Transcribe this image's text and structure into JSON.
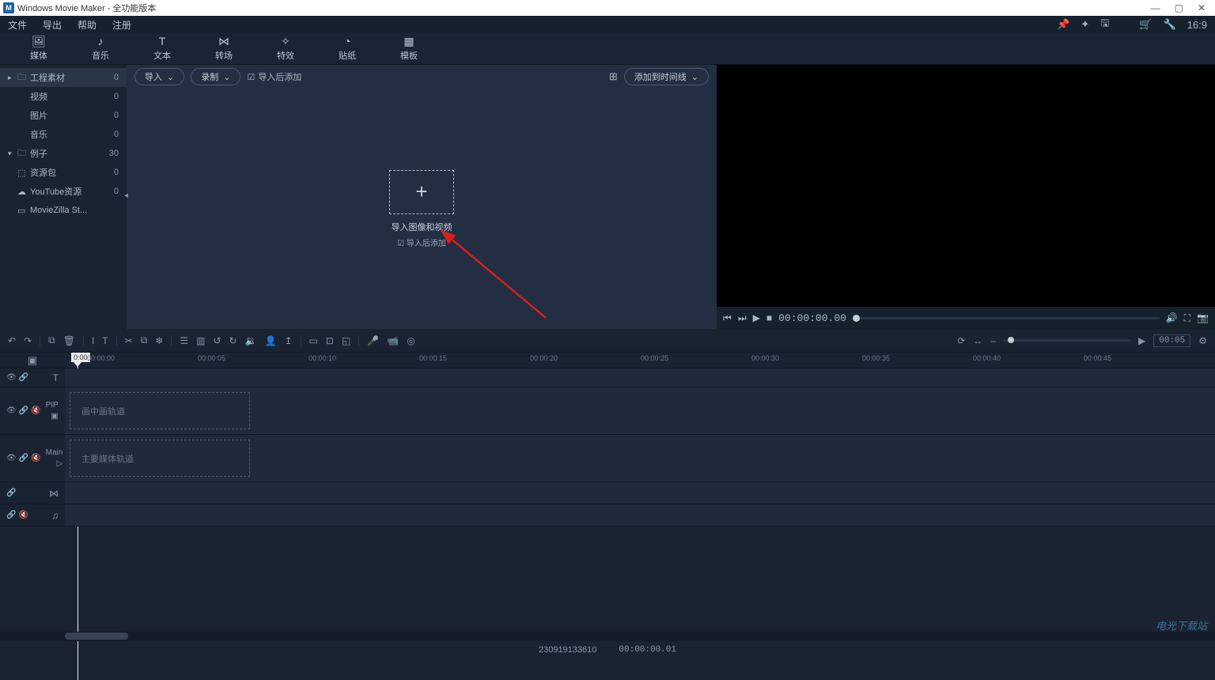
{
  "titlebar": {
    "app_name": "Windows Movie Maker",
    "subtitle": " - 全功能版本"
  },
  "menubar": {
    "items": [
      "文件",
      "导出",
      "帮助",
      "注册"
    ],
    "aspect": "16:9"
  },
  "tabs": [
    "媒体",
    "音乐",
    "文本",
    "转场",
    "特效",
    "贴纸",
    "模板"
  ],
  "sidebar": {
    "items": [
      {
        "label": "工程素材",
        "count": "0",
        "icon": "folder",
        "selected": true,
        "arrow": "▸"
      },
      {
        "label": "视频",
        "count": "0"
      },
      {
        "label": "图片",
        "count": "0"
      },
      {
        "label": "音乐",
        "count": "0"
      },
      {
        "label": "例子",
        "count": "30",
        "icon": "folder",
        "arrow": "▾"
      },
      {
        "label": "资源包",
        "count": "0",
        "icon": "cube"
      },
      {
        "label": "YouTube资源",
        "count": "0",
        "icon": "cloud"
      },
      {
        "label": "MovieZilla St...",
        "count": "",
        "icon": "store"
      }
    ]
  },
  "content_toolbar": {
    "import": "导入",
    "record": "录制",
    "check_label": "导入后添加",
    "add_timeline": "添加到时间线"
  },
  "dropzone": {
    "label": "导入图像和视频",
    "sub": "导入后添加"
  },
  "preview": {
    "timecode": "00:00:00.00"
  },
  "tl_toolbar": {
    "duration": "00:05"
  },
  "ruler": {
    "marks": [
      "00:00:00",
      "00:00:05",
      "00:00:10",
      "00:00:15",
      "00:00:20",
      "00:00:25",
      "00:00:30",
      "00:00:35",
      "00:00:40",
      "00:00:45"
    ],
    "playhead": "0:00"
  },
  "tracks": {
    "pip_label": "PIP",
    "pip_placeholder": "画中画轨道",
    "main_label": "Main",
    "main_placeholder": "主要媒体轨道"
  },
  "statusbar": {
    "id": "230919133610",
    "time": "00:00:00.01"
  },
  "watermark": "电光下载站"
}
